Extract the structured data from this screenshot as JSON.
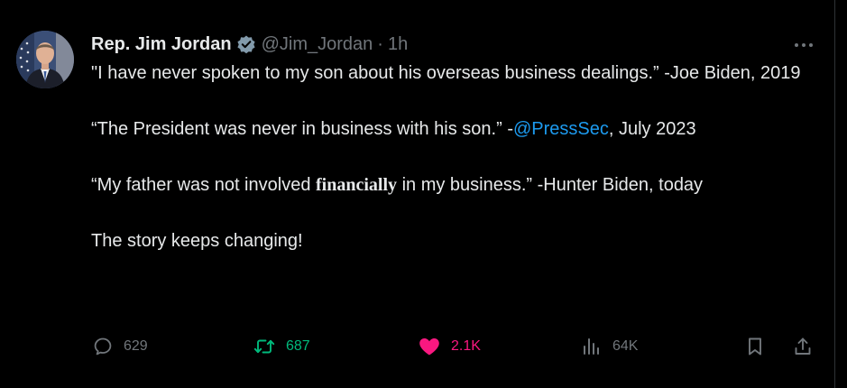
{
  "tweet": {
    "author_name": "Rep. Jim Jordan",
    "handle": "@Jim_Jordan",
    "separator": "·",
    "time": "1h",
    "verified": true,
    "paragraphs": [
      [
        {
          "text": "\"I have never spoken to my son about his overseas business dealings.” -Joe Biden, 2019"
        }
      ],
      [
        {
          "text": "“The President was never in business with his son.” -"
        },
        {
          "text": "@PressSec",
          "type": "mention"
        },
        {
          "text": ", July 2023"
        }
      ],
      [
        {
          "text": "“My father was not involved "
        },
        {
          "text": "financially",
          "type": "bold"
        },
        {
          "text": " in my business.” -Hunter Biden, today"
        }
      ],
      [
        {
          "text": "The story keeps changing!"
        }
      ]
    ],
    "actions": {
      "reply_count": "629",
      "retweet_count": "687",
      "like_count": "2.1K",
      "views_count": "64K"
    }
  },
  "colors": {
    "background": "#000000",
    "text": "#e7e9ea",
    "secondary": "#71767b",
    "link": "#1d9bf0",
    "retweet": "#00ba7c",
    "like": "#f91880"
  },
  "icons": [
    "avatar-photo",
    "verified-badge-icon",
    "more-options-icon",
    "reply-icon",
    "retweet-icon",
    "like-icon",
    "views-icon",
    "bookmark-icon",
    "share-icon"
  ]
}
